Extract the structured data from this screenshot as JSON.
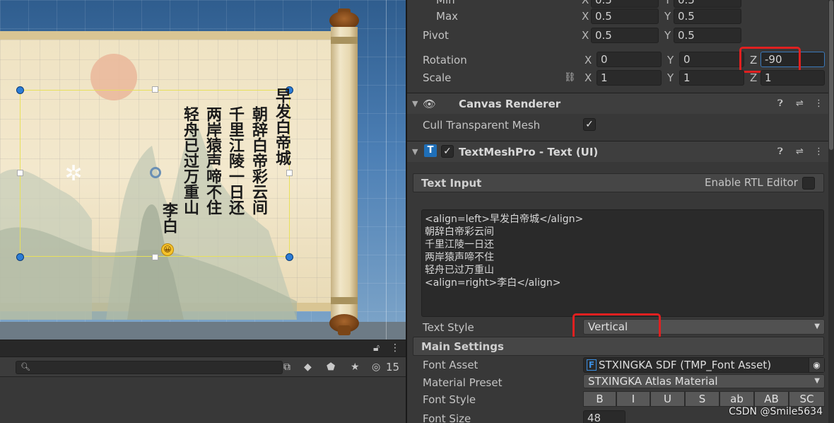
{
  "scene": {
    "poem_columns": [
      "早发白帝城",
      "朝辞白帝彩云间",
      "千里江陵一日还",
      "两岸猿声啼不住",
      "轻舟已过万重山",
      "李白"
    ],
    "emoji": "😀"
  },
  "bottom_toolbar": {
    "search_placeholder": "",
    "hidden_count": "15"
  },
  "inspector": {
    "rect_transform": {
      "min_label": "Min",
      "min_x": "0.5",
      "min_y": "0.5",
      "max_label": "Max",
      "max_x": "0.5",
      "max_y": "0.5",
      "pivot_label": "Pivot",
      "pivot_x": "0.5",
      "pivot_y": "0.5",
      "rotation_label": "Rotation",
      "rotation_x": "0",
      "rotation_y": "0",
      "rotation_z": "-90",
      "scale_label": "Scale",
      "scale_x": "1",
      "scale_y": "1",
      "scale_z": "1",
      "axis_x": "X",
      "axis_y": "Y",
      "axis_z": "Z"
    },
    "canvas_renderer": {
      "title": "Canvas Renderer",
      "cull_label": "Cull Transparent Mesh",
      "cull_checked": true
    },
    "tmp": {
      "title": "TextMeshPro - Text (UI)",
      "text_input_label": "Text Input",
      "rtl_label": "Enable RTL Editor",
      "text_lines": [
        "<align=left>早发白帝城</align>",
        "朝辞白帝彩云间",
        "千里江陵一日还",
        "两岸猿声啼不住",
        "轻舟已过万重山",
        "<align=right>李白</align>"
      ],
      "text_style_label": "Text Style",
      "text_style_value": "Vertical",
      "main_settings_label": "Main Settings",
      "font_asset_label": "Font Asset",
      "font_asset_value": "STXINGKA SDF (TMP_Font Asset)",
      "material_preset_label": "Material Preset",
      "material_preset_value": "STXINGKA Atlas Material",
      "font_style_label": "Font Style",
      "font_style_buttons": [
        "B",
        "I",
        "U",
        "S",
        "ab",
        "AB",
        "SC"
      ],
      "font_size_label": "Font Size",
      "font_size_value": "48"
    }
  },
  "watermark": "CSDN @Smile5634",
  "colors": {
    "highlight_box": "#e02020",
    "selection_handle": "#2b7cd6",
    "rect_outline": "#e8e05a"
  }
}
